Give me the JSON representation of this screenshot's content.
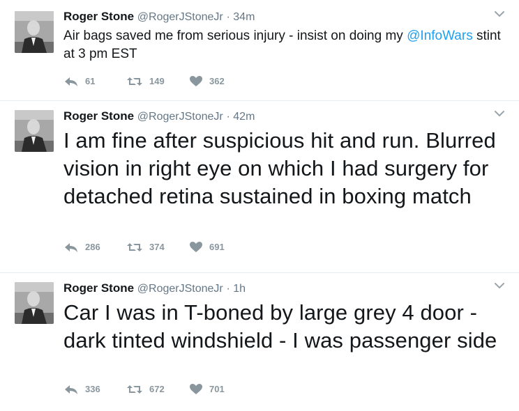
{
  "tweets": [
    {
      "name": "Roger Stone",
      "handle": "@RogerJStoneJr",
      "time": "· 34m",
      "text_parts": [
        "Air bags saved me from serious injury - insist on doing my ",
        "@InfoWars",
        " stint at 3 pm EST"
      ],
      "replies": "61",
      "retweets": "149",
      "likes": "362"
    },
    {
      "name": "Roger Stone",
      "handle": "@RogerJStoneJr",
      "time": "· 42m",
      "text": "I am fine after suspicious hit and run. Blurred vision in right eye on which I had surgery for detached retina sustained in boxing match",
      "replies": "286",
      "retweets": "374",
      "likes": "691"
    },
    {
      "name": "Roger Stone",
      "handle": "@RogerJStoneJr",
      "time": "· 1h",
      "text": "Car I was in T-boned by large grey 4 door - dark tinted windshield - I was passenger side",
      "replies": "336",
      "retweets": "672",
      "likes": "701"
    }
  ],
  "icons": {
    "reply": "reply-icon",
    "retweet": "retweet-icon",
    "like": "heart-icon",
    "more": "chevron-down-icon"
  },
  "colors": {
    "mention": "#1da1f2",
    "meta": "#657786",
    "action": "#8a969e",
    "divider": "#e6ecf0"
  }
}
